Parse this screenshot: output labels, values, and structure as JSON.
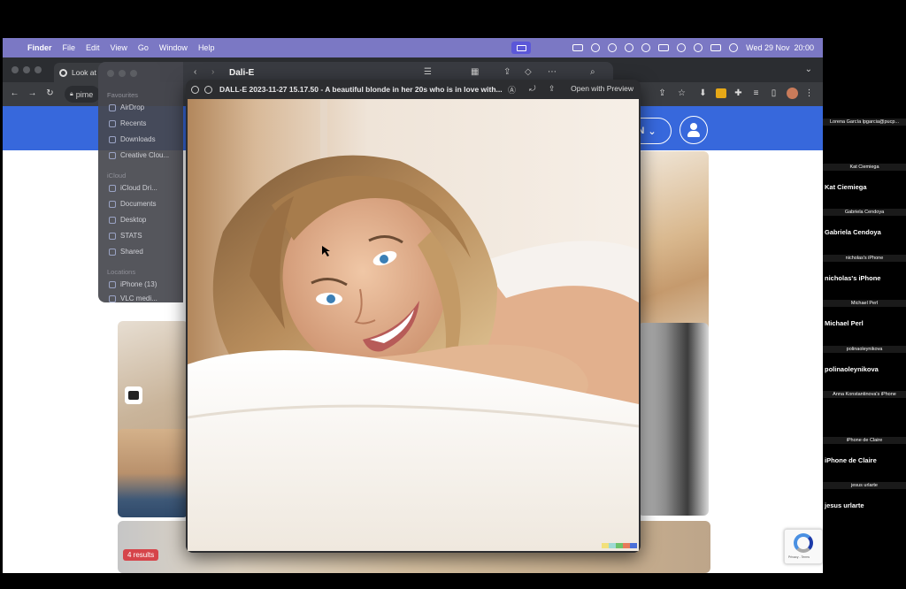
{
  "menubar": {
    "app_name": "Finder",
    "items": [
      "File",
      "Edit",
      "View",
      "Go",
      "Window",
      "Help"
    ],
    "clock": "Wed 29 Nov  20:00"
  },
  "browser": {
    "tab_title": "Look at",
    "url_fragment": "pime",
    "signin_label": "N",
    "results_badge": "4 results"
  },
  "finder": {
    "title": "Dali-E",
    "sections": {
      "favourites": "Favourites",
      "icloud": "iCloud",
      "locations": "Locations"
    },
    "favourites": [
      "AirDrop",
      "Recents",
      "Downloads",
      "Creative Clou..."
    ],
    "icloud": [
      "iCloud Dri...",
      "Documents",
      "Desktop",
      "STATS",
      "Shared"
    ],
    "locations": [
      "iPhone (13)",
      "VLC medi..."
    ]
  },
  "quicklook": {
    "title": "DALL-E 2023-11-27 15.17.50 - A beautiful blonde in her 20s who is in love with...",
    "open_with": "Open with Preview"
  },
  "participants": [
    {
      "label": "Lorena García lpgarcia@pucp...",
      "name": ""
    },
    {
      "label": "Kat Ciemiega",
      "name": "Kat Ciemiega"
    },
    {
      "label": "Gabriela Cendoya",
      "name": "Gabriela Cendoya"
    },
    {
      "label": "nicholas's iPhone",
      "name": "nicholas's iPhone"
    },
    {
      "label": "Michael Perl",
      "name": "Michael Perl"
    },
    {
      "label": "polinaoleynikova",
      "name": "polinaoleynikova"
    },
    {
      "label": "Anna Konstantinova's iPhone",
      "name": ""
    },
    {
      "label": "iPhone de Claire",
      "name": "iPhone de Claire"
    },
    {
      "label": "jesus urlarte",
      "name": "jesus urlarte"
    }
  ],
  "colors": {
    "menubar": "#7b78c4",
    "brand_blue": "#3768dc",
    "results_badge": "#d6444a"
  }
}
